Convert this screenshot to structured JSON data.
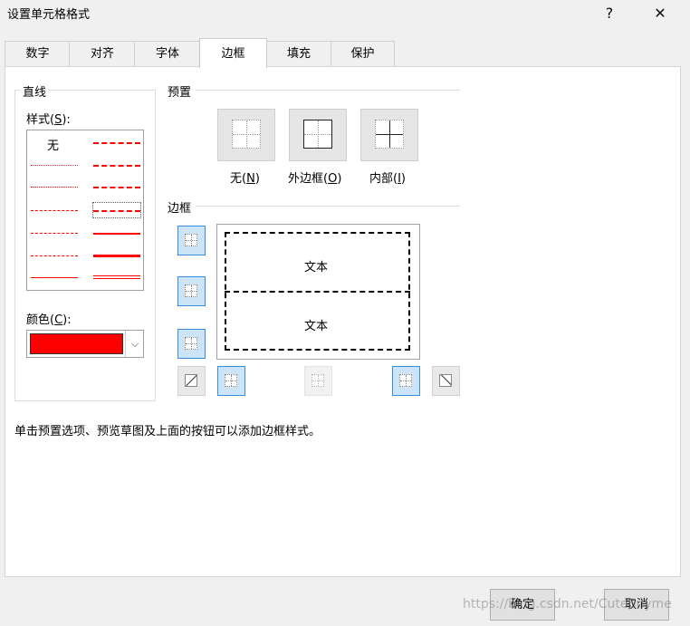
{
  "window": {
    "title": "设置单元格格式",
    "help": "?",
    "close": "✕"
  },
  "tabs": [
    {
      "label": "数字"
    },
    {
      "label": "对齐"
    },
    {
      "label": "字体"
    },
    {
      "label": "边框",
      "active": true
    },
    {
      "label": "填充"
    },
    {
      "label": "保护"
    }
  ],
  "line": {
    "group": "直线",
    "style_label": "样式(",
    "style_key": "S",
    "style_suffix": "):",
    "none": "无",
    "color_label": "颜色(",
    "color_key": "C",
    "color_suffix": "):",
    "selected_color": "#ff0000"
  },
  "presets": {
    "group": "预置",
    "items": [
      {
        "label_pre": "无(",
        "key": "N",
        "label_post": ")"
      },
      {
        "label_pre": "外边框(",
        "key": "O",
        "label_post": ")"
      },
      {
        "label_pre": "内部(",
        "key": "I",
        "label_post": ")"
      }
    ]
  },
  "border": {
    "group": "边框",
    "preview_text": "文本"
  },
  "hint": "单击预置选项、预览草图及上面的按钮可以添加边框样式。",
  "buttons": {
    "ok": "确定",
    "cancel": "取消"
  },
  "watermark": "https://blog.csdn.net/CuteSnyme"
}
